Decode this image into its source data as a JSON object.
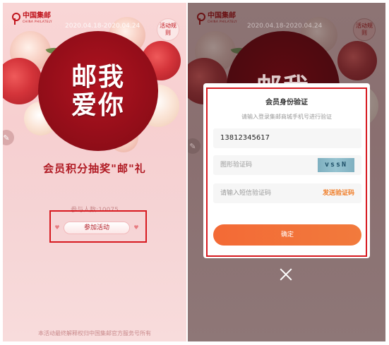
{
  "left_screen": {
    "logo": {
      "name": "中国集邮",
      "sub": "CHINA PHILATELY"
    },
    "date_range": "2020.04.18-2020.04.24",
    "rules_button": "活动规则",
    "banner_lines": [
      "邮我",
      "爱你"
    ],
    "subtitle": "会员积分抽奖\"邮\"礼",
    "participants": "参与人数:10075",
    "join_button": "参加活动",
    "footer": "本活动最终解释权归中国集邮官方服务号所有"
  },
  "right_screen": {
    "logo": {
      "name": "中国集邮",
      "sub": "CHINA PHILATELY"
    },
    "date_range": "2020.04.18-2020.04.24",
    "rules_button": "活动规则",
    "banner_lines": [
      "邮我"
    ],
    "modal": {
      "title": "会员身份验证",
      "hint": "请输入登录集邮商城手机号进行验证",
      "phone_value": "13812345617",
      "captcha_placeholder": "图形验证码",
      "captcha_text": "vssN",
      "sms_placeholder": "请输入短信验证码",
      "send_sms_label": "发送验证码",
      "confirm_label": "确定"
    }
  },
  "colors": {
    "brand_red": "#c0141c",
    "highlight": "#d7191f",
    "confirm_orange": "#f36a36",
    "send_sms_orange": "#f07e29"
  },
  "icons": [
    "china-post-logo-icon",
    "heart-icon",
    "close-icon",
    "edit-icon"
  ]
}
